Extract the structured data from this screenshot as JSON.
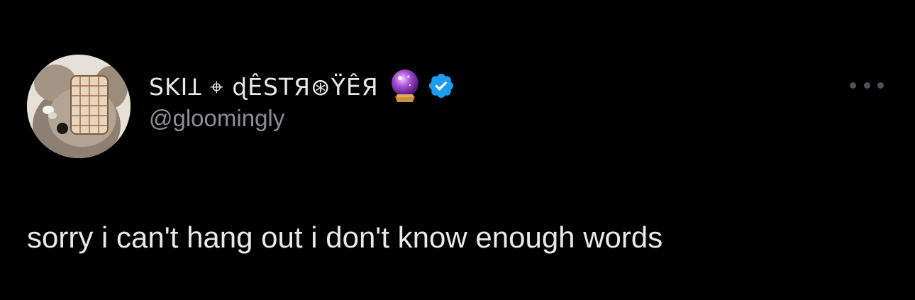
{
  "tweet": {
    "author": {
      "display_name": "SKIꞱ ⌖ ɖÊSTЯ⊛ΫÊЯ",
      "handle": "@gloomingly",
      "emoji": "crystal-ball-emoji",
      "verified": true
    },
    "text": "sorry i can't hang out i don't know enough words",
    "more_icon": "more-horizontal-icon"
  },
  "colors": {
    "background": "#000000",
    "primary_text": "#e7e9ea",
    "secondary_text": "#8b8f94",
    "verified_blue": "#1d9bf0",
    "more_dots": "#4f5256"
  }
}
